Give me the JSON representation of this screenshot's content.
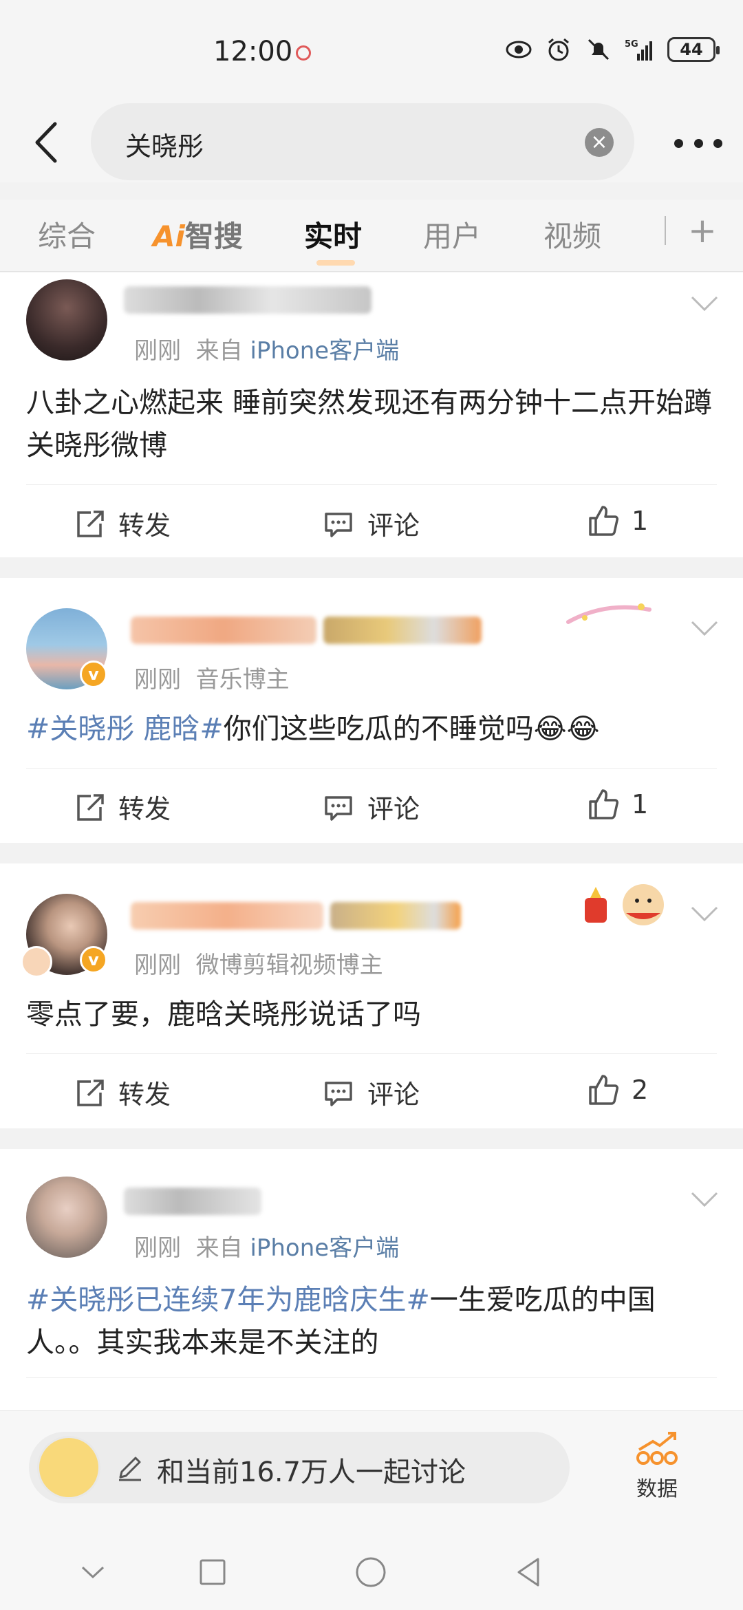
{
  "status_bar": {
    "time": "12:00",
    "battery": "44",
    "icons": [
      "eye-icon",
      "alarm-icon",
      "mute-icon",
      "signal-5g-icon",
      "battery-icon"
    ]
  },
  "search": {
    "query": "关晓彤"
  },
  "tabs": [
    {
      "label": "综合"
    },
    {
      "label_ai": "Ai",
      "label_rest": "智搜"
    },
    {
      "label": "实时",
      "active": true
    },
    {
      "label": "用户"
    },
    {
      "label": "视频"
    }
  ],
  "posts": [
    {
      "time": "刚刚",
      "source_prefix": "来自 ",
      "source": "iPhone客户端",
      "content": "八卦之心燃起来 睡前突然发现还有两分钟十二点开始蹲关晓彤微博",
      "repost": "转发",
      "comment": "评论",
      "like_count": "1"
    },
    {
      "time": "刚刚",
      "role": "音乐博主",
      "tag": "#关晓彤 鹿晗#",
      "content": "你们这些吃瓜的不睡觉吗😂😂",
      "repost": "转发",
      "comment": "评论",
      "like_count": "1"
    },
    {
      "time": "刚刚",
      "role": "微博剪辑视频博主",
      "content": "零点了要，鹿晗关晓彤说话了吗",
      "repost": "转发",
      "comment": "评论",
      "like_count": "2"
    },
    {
      "time": "刚刚",
      "source_prefix": "来自 ",
      "source": "iPhone客户端",
      "tag": "#关晓彤已连续7年为鹿晗庆生#",
      "content": "一生爱吃瓜的中国人。。其实我本来是不关注的"
    }
  ],
  "bottom": {
    "discuss_text": "和当前16.7万人一起讨论",
    "data_label": "数据"
  },
  "colors": {
    "link": "#5b7fb5",
    "accent": "#f6922d",
    "vbadge": "#f5a623"
  }
}
